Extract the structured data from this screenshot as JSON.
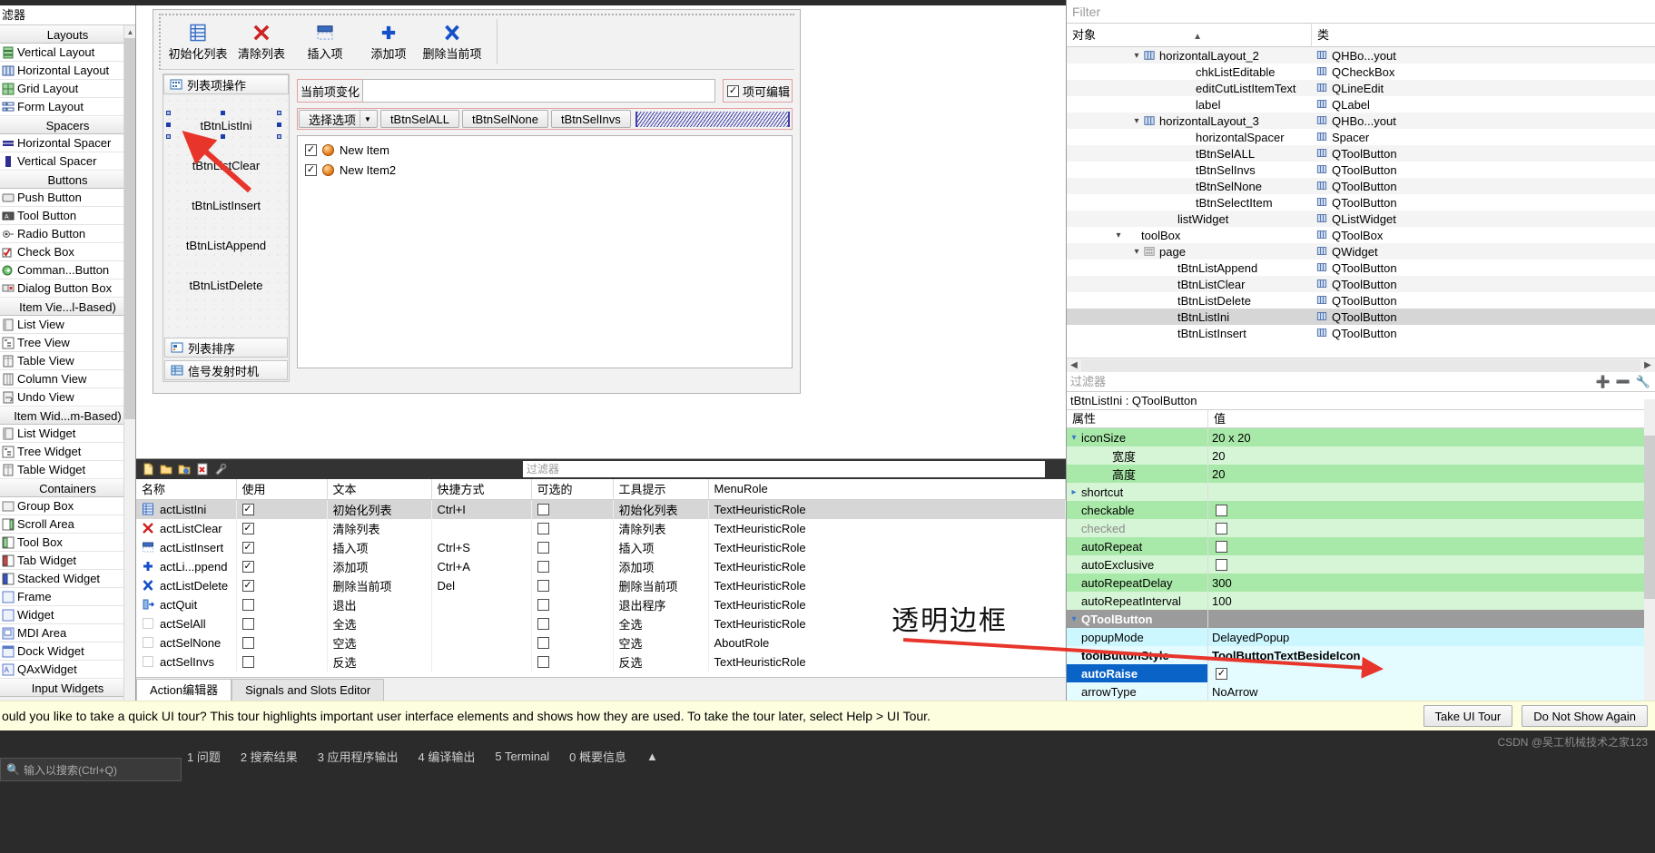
{
  "widget_box": {
    "filter_placeholder": "滤器",
    "groups": [
      {
        "title": "Layouts",
        "items": [
          {
            "label": "Vertical Layout",
            "icon": "vertical-layout-icon"
          },
          {
            "label": "Horizontal Layout",
            "icon": "horizontal-layout-icon"
          },
          {
            "label": "Grid Layout",
            "icon": "grid-layout-icon"
          },
          {
            "label": "Form Layout",
            "icon": "form-layout-icon"
          }
        ]
      },
      {
        "title": "Spacers",
        "items": [
          {
            "label": "Horizontal Spacer",
            "icon": "horizontal-spacer-icon"
          },
          {
            "label": "Vertical Spacer",
            "icon": "vertical-spacer-icon"
          }
        ]
      },
      {
        "title": "Buttons",
        "items": [
          {
            "label": "Push Button",
            "icon": "push-button-icon"
          },
          {
            "label": "Tool Button",
            "icon": "tool-button-icon"
          },
          {
            "label": "Radio Button",
            "icon": "radio-button-icon"
          },
          {
            "label": "Check Box",
            "icon": "check-box-icon"
          },
          {
            "label": "Comman...Button",
            "icon": "command-link-button-icon"
          },
          {
            "label": "Dialog Button Box",
            "icon": "dialog-button-box-icon"
          }
        ]
      },
      {
        "title": "Item Vie...l-Based)",
        "items": [
          {
            "label": "List View",
            "icon": "list-view-icon"
          },
          {
            "label": "Tree View",
            "icon": "tree-view-icon"
          },
          {
            "label": "Table View",
            "icon": "table-view-icon"
          },
          {
            "label": "Column View",
            "icon": "column-view-icon"
          },
          {
            "label": "Undo View",
            "icon": "undo-view-icon"
          }
        ]
      },
      {
        "title": "Item Wid...m-Based)",
        "items": [
          {
            "label": "List Widget",
            "icon": "list-widget-icon"
          },
          {
            "label": "Tree Widget",
            "icon": "tree-widget-icon"
          },
          {
            "label": "Table Widget",
            "icon": "table-widget-icon"
          }
        ]
      },
      {
        "title": "Containers",
        "items": [
          {
            "label": "Group Box",
            "icon": "group-box-icon"
          },
          {
            "label": "Scroll Area",
            "icon": "scroll-area-icon"
          },
          {
            "label": "Tool Box",
            "icon": "tool-box-icon"
          },
          {
            "label": "Tab Widget",
            "icon": "tab-widget-icon"
          },
          {
            "label": "Stacked Widget",
            "icon": "stacked-widget-icon"
          },
          {
            "label": "Frame",
            "icon": "frame-icon"
          },
          {
            "label": "Widget",
            "icon": "widget-icon"
          },
          {
            "label": "MDI Area",
            "icon": "mdi-area-icon"
          },
          {
            "label": "Dock Widget",
            "icon": "dock-widget-icon"
          },
          {
            "label": "QAxWidget",
            "icon": "qax-widget-icon"
          }
        ]
      },
      {
        "title": "Input Widgets",
        "items": []
      }
    ]
  },
  "form": {
    "toolbar": [
      {
        "label": "初始化列表",
        "icon": "list-init-icon"
      },
      {
        "label": "清除列表",
        "icon": "red-x-icon"
      },
      {
        "label": "插入项",
        "icon": "insert-item-icon"
      },
      {
        "label": "添加项",
        "icon": "blue-plus-icon"
      },
      {
        "label": "删除当前项",
        "icon": "blue-x-icon"
      }
    ],
    "toolbox": {
      "tabs": [
        {
          "label": "列表项操作",
          "icon": "list-ops-icon",
          "active": true
        },
        {
          "label": "列表排序",
          "icon": "list-sort-icon",
          "active": false
        },
        {
          "label": "信号发射时机",
          "icon": "signal-timing-icon",
          "active": false
        }
      ],
      "buttons": [
        {
          "label": "tBtnListIni",
          "selected": true
        },
        {
          "label": "tBtnListClear",
          "selected": false
        },
        {
          "label": "tBtnListInsert",
          "selected": false
        },
        {
          "label": "tBtnListAppend",
          "selected": false
        },
        {
          "label": "tBtnListDelete",
          "selected": false
        }
      ]
    },
    "current_item_label": "当前项变化",
    "current_item_value": "",
    "editable_checkbox": {
      "label": "项可编辑",
      "checked": true
    },
    "select_combo": "选择选项",
    "select_buttons": [
      "tBtnSelALL",
      "tBtnSelNone",
      "tBtnSelInvs"
    ],
    "list_items": [
      {
        "text": "New Item",
        "checked": true
      },
      {
        "text": "New Item2",
        "checked": true
      }
    ]
  },
  "action_editor": {
    "toolbar_icons": [
      "new-action-icon",
      "open-icon",
      "copy-icon",
      "delete-action-icon",
      "configure-icon"
    ],
    "filter_placeholder": "过滤器",
    "columns": [
      "名称",
      "使用",
      "文本",
      "快捷方式",
      "可选的",
      "工具提示",
      "MenuRole"
    ],
    "rows": [
      {
        "name": "actListIni",
        "icon": "list-init-icon",
        "used": true,
        "text": "初始化列表",
        "shortcut": "Ctrl+I",
        "checkable": false,
        "tooltip": "初始化列表",
        "menurole": "TextHeuristicRole",
        "selected": true
      },
      {
        "name": "actListClear",
        "icon": "red-x-icon",
        "used": true,
        "text": "清除列表",
        "shortcut": "",
        "checkable": false,
        "tooltip": "清除列表",
        "menurole": "TextHeuristicRole",
        "selected": false
      },
      {
        "name": "actListInsert",
        "icon": "insert-item-icon",
        "used": true,
        "text": "插入项",
        "shortcut": "Ctrl+S",
        "checkable": false,
        "tooltip": "插入项",
        "menurole": "TextHeuristicRole",
        "selected": false
      },
      {
        "name": "actLi...ppend",
        "icon": "blue-plus-icon",
        "used": true,
        "text": "添加项",
        "shortcut": "Ctrl+A",
        "checkable": false,
        "tooltip": "添加项",
        "menurole": "TextHeuristicRole",
        "selected": false
      },
      {
        "name": "actListDelete",
        "icon": "blue-x-icon",
        "used": true,
        "text": "删除当前项",
        "shortcut": "Del",
        "checkable": false,
        "tooltip": "删除当前项",
        "menurole": "TextHeuristicRole",
        "selected": false
      },
      {
        "name": "actQuit",
        "icon": "quit-icon",
        "used": false,
        "text": "退出",
        "shortcut": "",
        "checkable": false,
        "tooltip": "退出程序",
        "menurole": "TextHeuristicRole",
        "selected": false
      },
      {
        "name": "actSelAll",
        "icon": "blank-icon",
        "used": false,
        "text": "全选",
        "shortcut": "",
        "checkable": false,
        "tooltip": "全选",
        "menurole": "TextHeuristicRole",
        "selected": false
      },
      {
        "name": "actSelNone",
        "icon": "blank-icon",
        "used": false,
        "text": "空选",
        "shortcut": "",
        "checkable": false,
        "tooltip": "空选",
        "menurole": "AboutRole",
        "selected": false
      },
      {
        "name": "actSelInvs",
        "icon": "blank-icon",
        "used": false,
        "text": "反选",
        "shortcut": "",
        "checkable": false,
        "tooltip": "反选",
        "menurole": "TextHeuristicRole",
        "selected": false
      }
    ],
    "tabs": [
      {
        "label": "Action编辑器",
        "active": true
      },
      {
        "label": "Signals and Slots Editor",
        "active": false
      }
    ]
  },
  "object_inspector": {
    "filter_placeholder": "Filter",
    "col_object": "对象",
    "col_class": "类",
    "rows": [
      {
        "name": "horizontalLayout_2",
        "cls": "QHBo...yout",
        "indent": 3,
        "caret": "v",
        "icon": "hlayout-icon"
      },
      {
        "name": "chkListEditable",
        "cls": "QCheckBox",
        "indent": 5,
        "caret": "",
        "icon": ""
      },
      {
        "name": "editCutListItemText",
        "cls": "QLineEdit",
        "indent": 5,
        "caret": "",
        "icon": ""
      },
      {
        "name": "label",
        "cls": "QLabel",
        "indent": 5,
        "caret": "",
        "icon": ""
      },
      {
        "name": "horizontalLayout_3",
        "cls": "QHBo...yout",
        "indent": 3,
        "caret": "v",
        "icon": "hlayout-icon"
      },
      {
        "name": "horizontalSpacer",
        "cls": "Spacer",
        "indent": 5,
        "caret": "",
        "icon": ""
      },
      {
        "name": "tBtnSelALL",
        "cls": "QToolButton",
        "indent": 5,
        "caret": "",
        "icon": ""
      },
      {
        "name": "tBtnSelInvs",
        "cls": "QToolButton",
        "indent": 5,
        "caret": "",
        "icon": ""
      },
      {
        "name": "tBtnSelNone",
        "cls": "QToolButton",
        "indent": 5,
        "caret": "",
        "icon": ""
      },
      {
        "name": "tBtnSelectItem",
        "cls": "QToolButton",
        "indent": 5,
        "caret": "",
        "icon": ""
      },
      {
        "name": "listWidget",
        "cls": "QListWidget",
        "indent": 4,
        "caret": "",
        "icon": ""
      },
      {
        "name": "toolBox",
        "cls": "QToolBox",
        "indent": 2,
        "caret": "v",
        "icon": ""
      },
      {
        "name": "page",
        "cls": "QWidget",
        "indent": 3,
        "caret": "v",
        "icon": "page-icon"
      },
      {
        "name": "tBtnListAppend",
        "cls": "QToolButton",
        "indent": 4,
        "caret": "",
        "icon": ""
      },
      {
        "name": "tBtnListClear",
        "cls": "QToolButton",
        "indent": 4,
        "caret": "",
        "icon": ""
      },
      {
        "name": "tBtnListDelete",
        "cls": "QToolButton",
        "indent": 4,
        "caret": "",
        "icon": ""
      },
      {
        "name": "tBtnListIni",
        "cls": "QToolButton",
        "indent": 4,
        "caret": "",
        "icon": "",
        "selected": true
      },
      {
        "name": "tBtnListInsert",
        "cls": "QToolButton",
        "indent": 4,
        "caret": "",
        "icon": ""
      }
    ]
  },
  "property_editor": {
    "filter_placeholder": "过滤器",
    "object_line": "tBtnListIni : QToolButton",
    "col_property": "属性",
    "col_value": "值",
    "rows": [
      {
        "key": "iconSize",
        "value": "20 x 20",
        "caret": "v",
        "tone": "g1",
        "indent": 0
      },
      {
        "key": "宽度",
        "value": "20",
        "caret": "",
        "tone": "g2",
        "indent": 1
      },
      {
        "key": "高度",
        "value": "20",
        "caret": "",
        "tone": "g1",
        "indent": 1
      },
      {
        "key": "shortcut",
        "value": "",
        "caret": ">",
        "tone": "g2",
        "indent": 0
      },
      {
        "key": "checkable",
        "value": "",
        "caret": "",
        "tone": "g1",
        "indent": 0,
        "checkbox": false
      },
      {
        "key": "checked",
        "value": "",
        "caret": "",
        "tone": "g2",
        "indent": 0,
        "checkbox": false,
        "disabled": true
      },
      {
        "key": "autoRepeat",
        "value": "",
        "caret": "",
        "tone": "g1",
        "indent": 0,
        "checkbox": false
      },
      {
        "key": "autoExclusive",
        "value": "",
        "caret": "",
        "tone": "g2",
        "indent": 0,
        "checkbox": false
      },
      {
        "key": "autoRepeatDelay",
        "value": "300",
        "caret": "",
        "tone": "g1",
        "indent": 0
      },
      {
        "key": "autoRepeatInterval",
        "value": "100",
        "caret": "",
        "tone": "g2",
        "indent": 0
      },
      {
        "key": "QToolButton",
        "value": "",
        "caret": "v",
        "tone": "grp",
        "indent": 0
      },
      {
        "key": "popupMode",
        "value": "DelayedPopup",
        "caret": "",
        "tone": "c1b",
        "indent": 0
      },
      {
        "key": "toolButtonStyle",
        "value": "ToolButtonTextBesideIcon",
        "caret": "",
        "tone": "c2b",
        "indent": 0,
        "bold": true
      },
      {
        "key": "autoRaise",
        "value": "",
        "caret": "",
        "tone": "sel",
        "indent": 0,
        "checkbox": true
      },
      {
        "key": "arrowType",
        "value": "NoArrow",
        "caret": "",
        "tone": "c2b",
        "indent": 0
      }
    ]
  },
  "annotation": {
    "transparent_border_note": "透明边框"
  },
  "tour_bar": {
    "message": "ould you like to take a quick UI tour? This tour highlights important user interface elements and shows how they are used. To take the tour later, select Help > UI Tour.",
    "take_tour": "Take UI Tour",
    "dismiss": "Do Not Show Again"
  },
  "bottom_bar": {
    "task_placeholder": "输入以搜索(Ctrl+Q)",
    "items": [
      "1 问题",
      "2 搜索结果",
      "3 应用程序输出",
      "4 编译输出",
      "5 Terminal",
      "0 概要信息"
    ],
    "watermark": "CSDN @吴工机械技术之家123"
  },
  "colors": {
    "accent_blue": "#0a64c8",
    "green_prop": "#a8e8a8",
    "cyan_prop": "#ccf7ff",
    "annotation_red": "#e8352b",
    "tour_bg": "#fdfde0"
  }
}
